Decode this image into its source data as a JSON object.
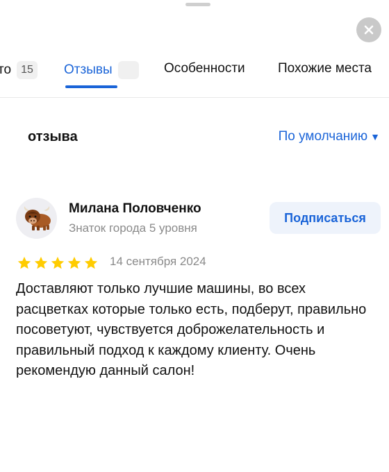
{
  "tabs": [
    {
      "label": "то",
      "badge": "15"
    },
    {
      "label": "Отзывы",
      "badge": ""
    },
    {
      "label": "Особенности"
    },
    {
      "label": "Похожие места"
    }
  ],
  "reviews_header": {
    "count_label": "отзыва",
    "sort_label": "По умолчанию"
  },
  "review": {
    "author_name": "Милана Половченко",
    "author_level": "Знаток города 5 уровня",
    "subscribe_label": "Подписаться",
    "rating": 5,
    "rating_max": 5,
    "date": "14 сентября 2024",
    "text": "Доставляют только лучшие машины, во всех расцветках которые только есть, подберут, правильно посоветуют, чувствуется доброжелательность и правильный подход к каждому клиенту. Очень рекомендую данный салон!"
  },
  "colors": {
    "accent": "#1a64d8",
    "star": "#ffcc00",
    "muted_text": "#8a8a8a"
  },
  "icons": {
    "close": "close-icon",
    "avatar": "yak-avatar-icon",
    "star": "star-icon",
    "sort": "caret-down-icon"
  }
}
